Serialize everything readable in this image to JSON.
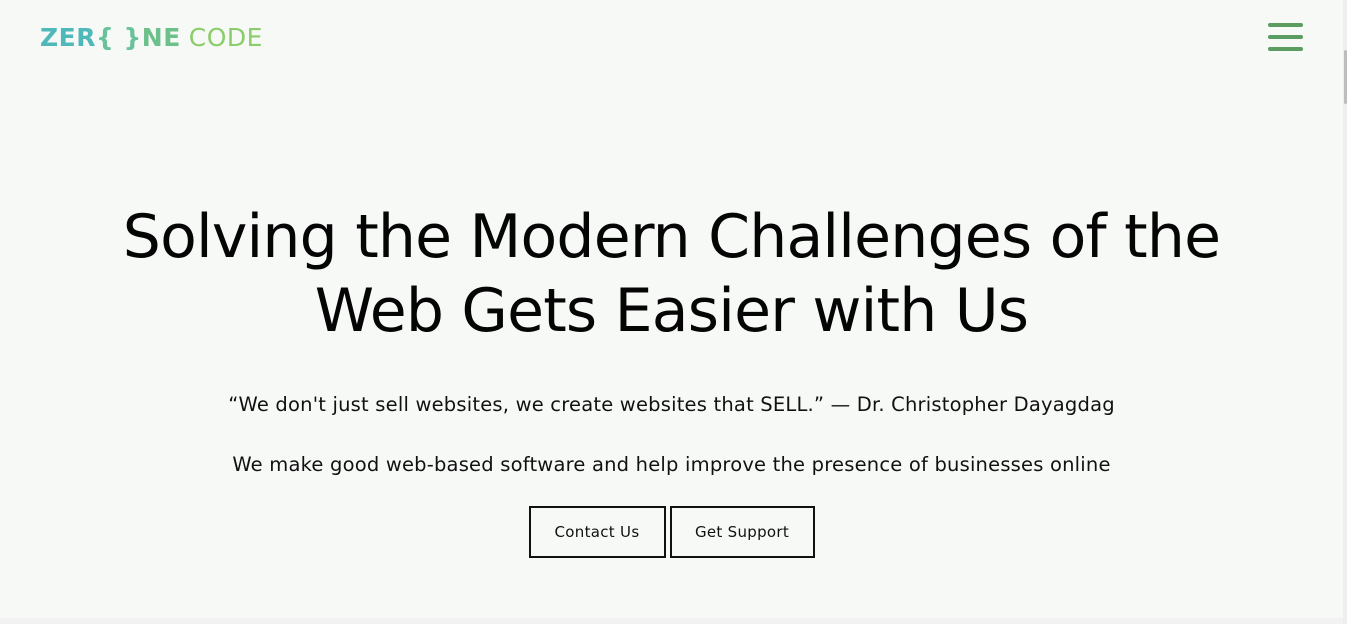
{
  "header": {
    "logo": {
      "part_zer": "ZER",
      "part_braces": "{ }",
      "part_ne": "NE",
      "part_code": "CODE"
    },
    "menu_icon": "hamburger-menu-icon"
  },
  "hero": {
    "title": "Solving the Modern Challenges of the Web Gets Easier with Us",
    "quote": "“We don't just sell websites, we create websites that SELL.” — Dr. Christopher Dayagdag",
    "tagline": "We make good web-based software and help improve the presence of businesses online",
    "buttons": {
      "contact": "Contact Us",
      "support": "Get Support"
    }
  },
  "colors": {
    "background": "#f7f9f7",
    "logo_teal": "#4fb8b8",
    "logo_green": "#8bcd6a",
    "menu_green": "#5b9c61",
    "text": "#0a0a0a"
  }
}
